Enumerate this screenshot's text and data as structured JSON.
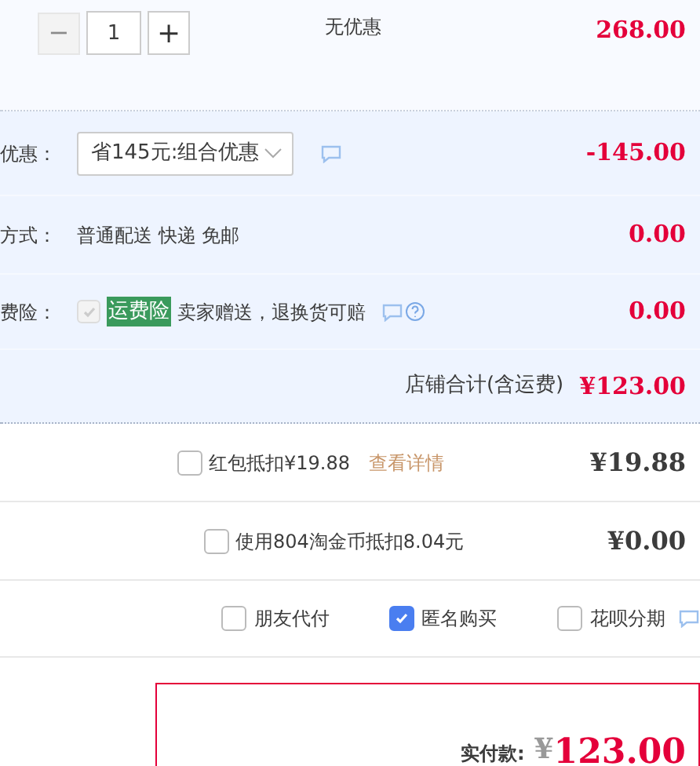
{
  "item": {
    "quantity": "1",
    "minus_disabled": true,
    "minus": "−",
    "plus": "+",
    "discount": "无优惠",
    "price": "268.00"
  },
  "order_rows": [
    {
      "kind": "select",
      "label": "优惠：",
      "value": "省145元:组合优惠",
      "amount": "-145.00"
    },
    {
      "kind": "text",
      "label": "方式：",
      "value": "普通配送 快递 免邮",
      "amount": "0.00"
    },
    {
      "kind": "insurance",
      "label": "费险：",
      "checked": true,
      "disabled": true,
      "tag": "运费险",
      "value": "卖家赠送，退换货可赔",
      "amount": "0.00"
    }
  ],
  "shop_total": {
    "label": "店铺合计(含运费)",
    "amount": "¥123.00"
  },
  "deductions": [
    {
      "checked": false,
      "label": "红包抵扣¥19.88",
      "link": "查看详情",
      "amount": "¥19.88"
    },
    {
      "checked": false,
      "label": "使用804淘金币抵扣8.04元",
      "amount": "¥0.00"
    }
  ],
  "options": [
    {
      "label": "朋友代付",
      "checked": false
    },
    {
      "label": "匿名购买",
      "checked": true
    },
    {
      "label": "花呗分期",
      "checked": false,
      "info": true
    }
  ],
  "payment": {
    "label": "实付款:",
    "currency": "¥",
    "amount": "123.00"
  }
}
